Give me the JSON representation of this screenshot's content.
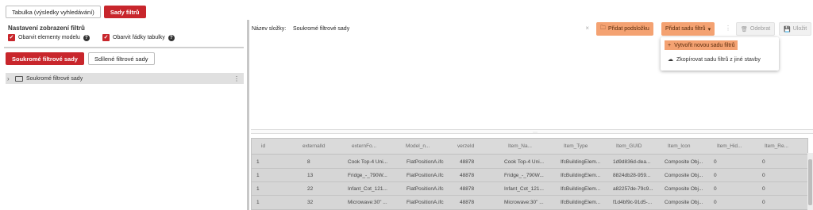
{
  "top_tabs": [
    "Tabulka (výsledky vyhledávání)",
    "Sady filtrů"
  ],
  "settings": {
    "title": "Nastavení zobrazení filtrů",
    "option_model": "Obarvit elementy modelu",
    "option_rows": "Obarvit řádky tabulky"
  },
  "set_tabs": [
    "Soukromé filtrové sady",
    "Sdílené filtrové sady"
  ],
  "tree": {
    "folder_label": "Soukromé filtrové sady"
  },
  "toolbar": {
    "folder_name_label": "Název složky:",
    "folder_name_value": "Soukromé filtrové sady",
    "add_subfolder": "Přidat podsložku",
    "add_filter_set": "Přidat sadu filtrů",
    "remove": "Odebrat",
    "save": "Uložit"
  },
  "dropdown": {
    "create_new": "Vytvořit novou sadu filtrů",
    "copy_from": "Zkopírovat sadu filtrů z jiné stavby"
  },
  "table": {
    "columns": [
      "id",
      "externalId",
      "externFo...",
      "Model_n...",
      "verzeId",
      "Item_Na...",
      "Item_Type",
      "Item_GUID",
      "Item_Icon",
      "Item_Hid...",
      "Item_Re..."
    ],
    "rows": [
      [
        "1",
        "8",
        "Cook Top-4 Uni...",
        "FlatPositionA.ifc",
        "48878",
        "Cook Top-4 Uni...",
        "IfcBuildingElem...",
        "1d9d836d-dea...",
        "Composite Obj...",
        "0",
        "0"
      ],
      [
        "1",
        "13",
        "Fridge_-_790W...",
        "FlatPositionA.ifc",
        "48878",
        "Fridge_-_790W...",
        "IfcBuildingElem...",
        "8824db28-959...",
        "Composite Obj...",
        "0",
        "0"
      ],
      [
        "1",
        "22",
        "Infant_Cot_121...",
        "FlatPositionA.ifc",
        "48878",
        "Infant_Cot_121...",
        "IfcBuildingElem...",
        "a82257de-79c9...",
        "Composite Obj...",
        "0",
        "0"
      ],
      [
        "1",
        "32",
        "Microwave:30\" ...",
        "FlatPositionA.ifc",
        "48878",
        "Microwave:30\" ...",
        "IfcBuildingElem...",
        "f1d4bf9c-91d5-...",
        "Composite Obj...",
        "0",
        "0"
      ]
    ]
  }
}
